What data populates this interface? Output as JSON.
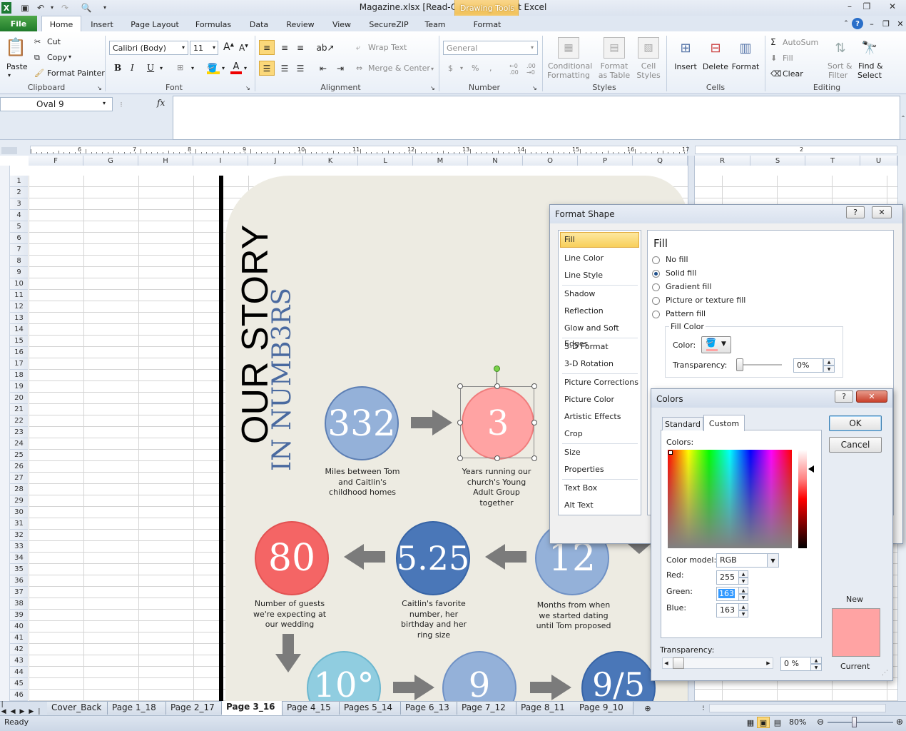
{
  "window": {
    "title": "Magazine.xlsx  [Read-Only]  -  Microsoft Excel",
    "contextual_tab_group": "Drawing Tools"
  },
  "tabs": {
    "file": "File",
    "home": "Home",
    "insert": "Insert",
    "page_layout": "Page Layout",
    "formulas": "Formulas",
    "data": "Data",
    "review": "Review",
    "view": "View",
    "securezip": "SecureZIP",
    "team": "Team",
    "format": "Format"
  },
  "ribbon": {
    "clipboard": {
      "paste": "Paste",
      "cut": "Cut",
      "copy": "Copy",
      "format_painter": "Format Painter",
      "label": "Clipboard"
    },
    "font": {
      "name": "Calibri (Body)",
      "size": "11",
      "label": "Font"
    },
    "alignment": {
      "wrap_text": "Wrap Text",
      "merge_center": "Merge & Center",
      "label": "Alignment"
    },
    "number": {
      "format": "General",
      "label": "Number"
    },
    "styles": {
      "conditional": "Conditional",
      "conditional2": "Formatting",
      "format_table": "Format",
      "format_table2": "as Table",
      "cell_styles": "Cell",
      "cell_styles2": "Styles",
      "label": "Styles"
    },
    "cells": {
      "insert": "Insert",
      "delete": "Delete",
      "format": "Format",
      "label": "Cells"
    },
    "editing": {
      "autosum": "AutoSum",
      "fill": "Fill",
      "clear": "Clear",
      "sort": "Sort &",
      "sort2": "Filter",
      "find": "Find &",
      "find2": "Select",
      "label": "Editing"
    }
  },
  "formula_bar": {
    "name_box": "Oval 9",
    "fx": "fx",
    "formula": ""
  },
  "columns_left": [
    "F",
    "G",
    "H",
    "I",
    "J",
    "K",
    "L",
    "M",
    "N",
    "O",
    "P",
    "Q"
  ],
  "columns_right": [
    "R",
    "S",
    "T",
    "U"
  ],
  "ruler_numbers": [
    "6",
    "7",
    "8",
    "9",
    "10",
    "11",
    "12",
    "13",
    "14",
    "15",
    "16",
    "17"
  ],
  "ruler_right_number": "2",
  "rows": [
    "1",
    "2",
    "3",
    "4",
    "5",
    "6",
    "7",
    "8",
    "9",
    "10",
    "11",
    "12",
    "13",
    "14",
    "15",
    "16",
    "17",
    "18",
    "19",
    "20",
    "21",
    "22",
    "23",
    "24",
    "25",
    "26",
    "27",
    "28",
    "29",
    "30",
    "31",
    "32",
    "33",
    "34",
    "35",
    "36",
    "37",
    "38",
    "39",
    "40",
    "41",
    "42",
    "43",
    "44",
    "45",
    "46"
  ],
  "infographic": {
    "title1": "OUR STORY",
    "title2": "IN NUMB3RS",
    "stats": [
      {
        "value": "332",
        "caption": "Miles between Tom and Caitlin's childhood homes"
      },
      {
        "value": "3",
        "caption": "Years running our church's Young Adult Group together"
      },
      {
        "value": "80",
        "caption": "Number of guests we're expecting at our wedding"
      },
      {
        "value": "5.25",
        "caption": "Caitlin's favorite number, her birthday and her ring size"
      },
      {
        "value": "12",
        "caption": "Months from when we started dating until Tom proposed"
      },
      {
        "value": "10°",
        "caption": ""
      },
      {
        "value": "9",
        "caption": ""
      },
      {
        "value": "9/5",
        "caption": ""
      }
    ],
    "colors": {
      "light_blue": "#94b1d9",
      "pink": "#ffa3a3",
      "red": "#f46565",
      "dark_blue": "#4a77b8",
      "teal": "#90cde0",
      "beige": "#edebe2"
    }
  },
  "format_shape": {
    "title": "Format Shape",
    "nav": [
      "Fill",
      "Line Color",
      "Line Style",
      "Shadow",
      "Reflection",
      "Glow and Soft Edges",
      "3-D Format",
      "3-D Rotation",
      "Picture Corrections",
      "Picture Color",
      "Artistic Effects",
      "Crop",
      "Size",
      "Properties",
      "Text Box",
      "Alt Text"
    ],
    "heading": "Fill",
    "options": [
      "No fill",
      "Solid fill",
      "Gradient fill",
      "Picture or texture fill",
      "Pattern fill"
    ],
    "selected_option": "Solid fill",
    "fill_color_group": "Fill Color",
    "color_label": "Color:",
    "transparency_label": "Transparency:",
    "transparency_value": "0%"
  },
  "colors_dialog": {
    "title": "Colors",
    "tabs": [
      "Standard",
      "Custom"
    ],
    "active_tab": "Custom",
    "colors_label": "Colors:",
    "ok": "OK",
    "cancel": "Cancel",
    "model_label": "Color model:",
    "model": "RGB",
    "red_label": "Red:",
    "red": "255",
    "green_label": "Green:",
    "green": "163",
    "blue_label": "Blue:",
    "blue": "163",
    "transparency_label": "Transparency:",
    "transparency_value": "0 %",
    "new_label": "New",
    "current_label": "Current",
    "new_color": "#ffa3a3"
  },
  "sheets": [
    "Cover_Back",
    "Page 1_18",
    "Page 2_17",
    "Page 3_16",
    "Page 4_15",
    "Pages 5_14",
    "Page 6_13",
    "Page 7_12",
    "Page 8_11",
    "Page 9_10"
  ],
  "active_sheet": "Page 3_16",
  "status": {
    "ready": "Ready",
    "zoom": "80%"
  }
}
